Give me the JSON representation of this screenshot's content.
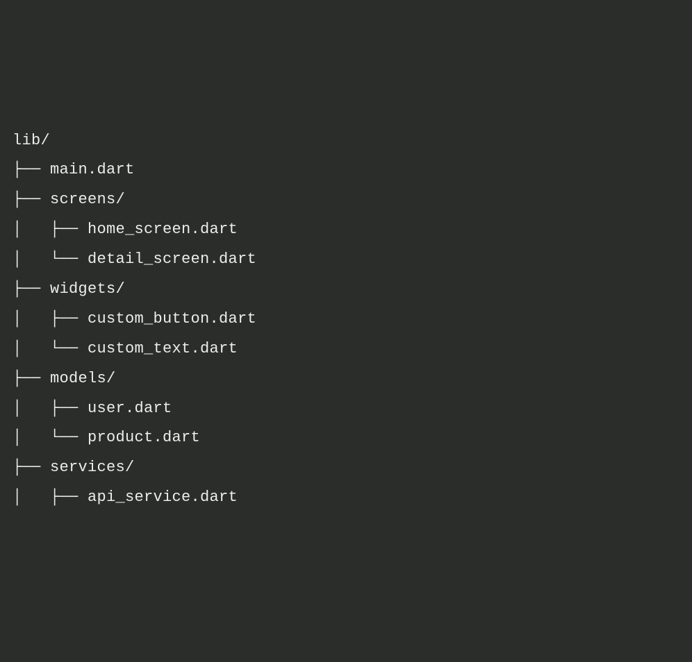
{
  "tree": {
    "lines": [
      "lib/",
      "├── main.dart",
      "├── screens/",
      "│   ├── home_screen.dart",
      "│   └── detail_screen.dart",
      "├── widgets/",
      "│   ├── custom_button.dart",
      "│   └── custom_text.dart",
      "├── models/",
      "│   ├── user.dart",
      "│   └── product.dart",
      "├── services/",
      "│   ├── api_service.dart"
    ]
  }
}
